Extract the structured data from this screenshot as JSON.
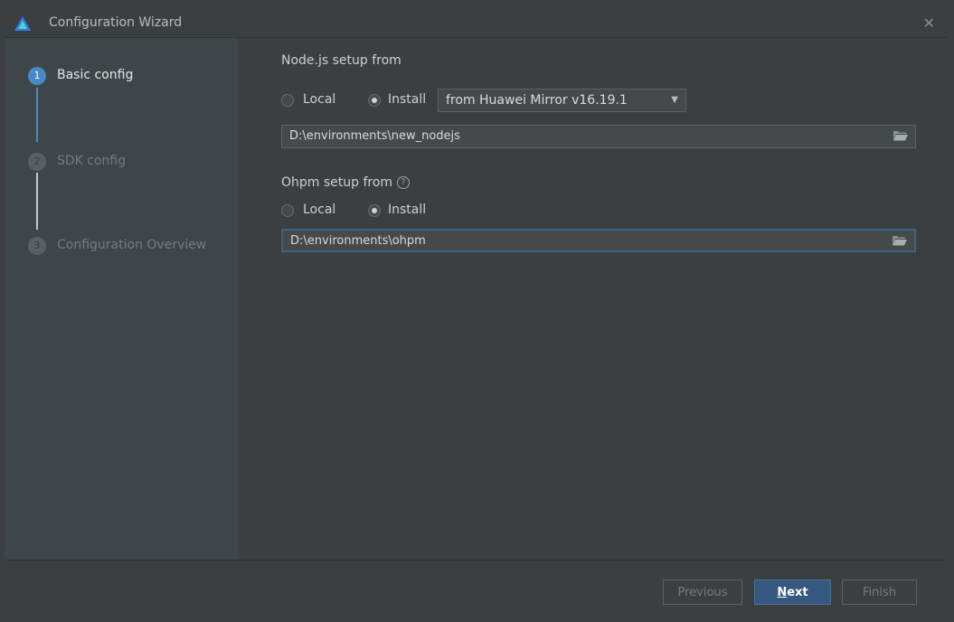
{
  "window": {
    "title": "Configuration Wizard",
    "logo_icon": "app-logo-icon",
    "close_icon": "close-icon"
  },
  "steps": [
    {
      "num": "1",
      "label": "Basic config",
      "active": true
    },
    {
      "num": "2",
      "label": "SDK config",
      "active": false
    },
    {
      "num": "3",
      "label": "Configuration Overview",
      "active": false
    }
  ],
  "nodejs": {
    "section_label": "Node.js setup from",
    "options": [
      {
        "label": "Local",
        "checked": false
      },
      {
        "label": "Install",
        "checked": true
      }
    ],
    "mirror_select": "from Huawei Mirror v16.19.1",
    "path": "D:\\environments\\new_nodejs"
  },
  "ohpm": {
    "section_label": "Ohpm setup from",
    "options": [
      {
        "label": "Local",
        "checked": false
      },
      {
        "label": "Install",
        "checked": true
      }
    ],
    "path": "D:\\environments\\ohpm"
  },
  "footer": {
    "previous": "Previous",
    "next_mnemonic": "N",
    "next_rest": "ext",
    "finish": "Finish"
  },
  "colors": {
    "accent": "#4a88c7",
    "primary_button": "#365880",
    "sidebar_bg": "#3f4649",
    "window_bg": "#3c3f41"
  }
}
